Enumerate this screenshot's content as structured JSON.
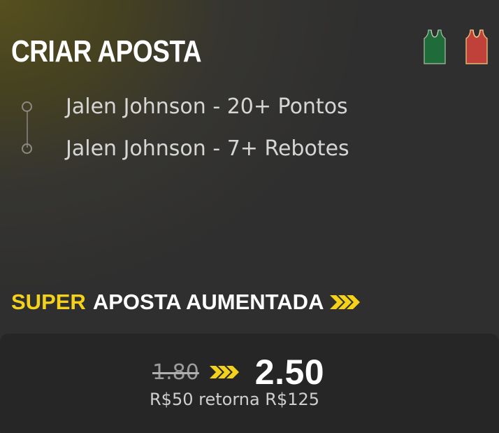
{
  "header": {
    "title": "CRIAR APOSTA",
    "jerseys": [
      {
        "icon": "green-jersey-icon",
        "color": "#1f6b3a",
        "trim": "#b8c8b0"
      },
      {
        "icon": "red-jersey-icon",
        "color": "#c0403a",
        "trim": "#e8c27a"
      }
    ]
  },
  "selections": [
    {
      "label": "Jalen Johnson - 20+ Pontos"
    },
    {
      "label": "Jalen Johnson - 7+ Rebotes"
    }
  ],
  "boost": {
    "highlight": "SUPER",
    "title": "APOSTA AUMENTADA",
    "accent_color": "#f4d21b"
  },
  "odds": {
    "original": "1.80",
    "boosted": "2.50",
    "returns_text": "R$50 retorna R$125"
  }
}
